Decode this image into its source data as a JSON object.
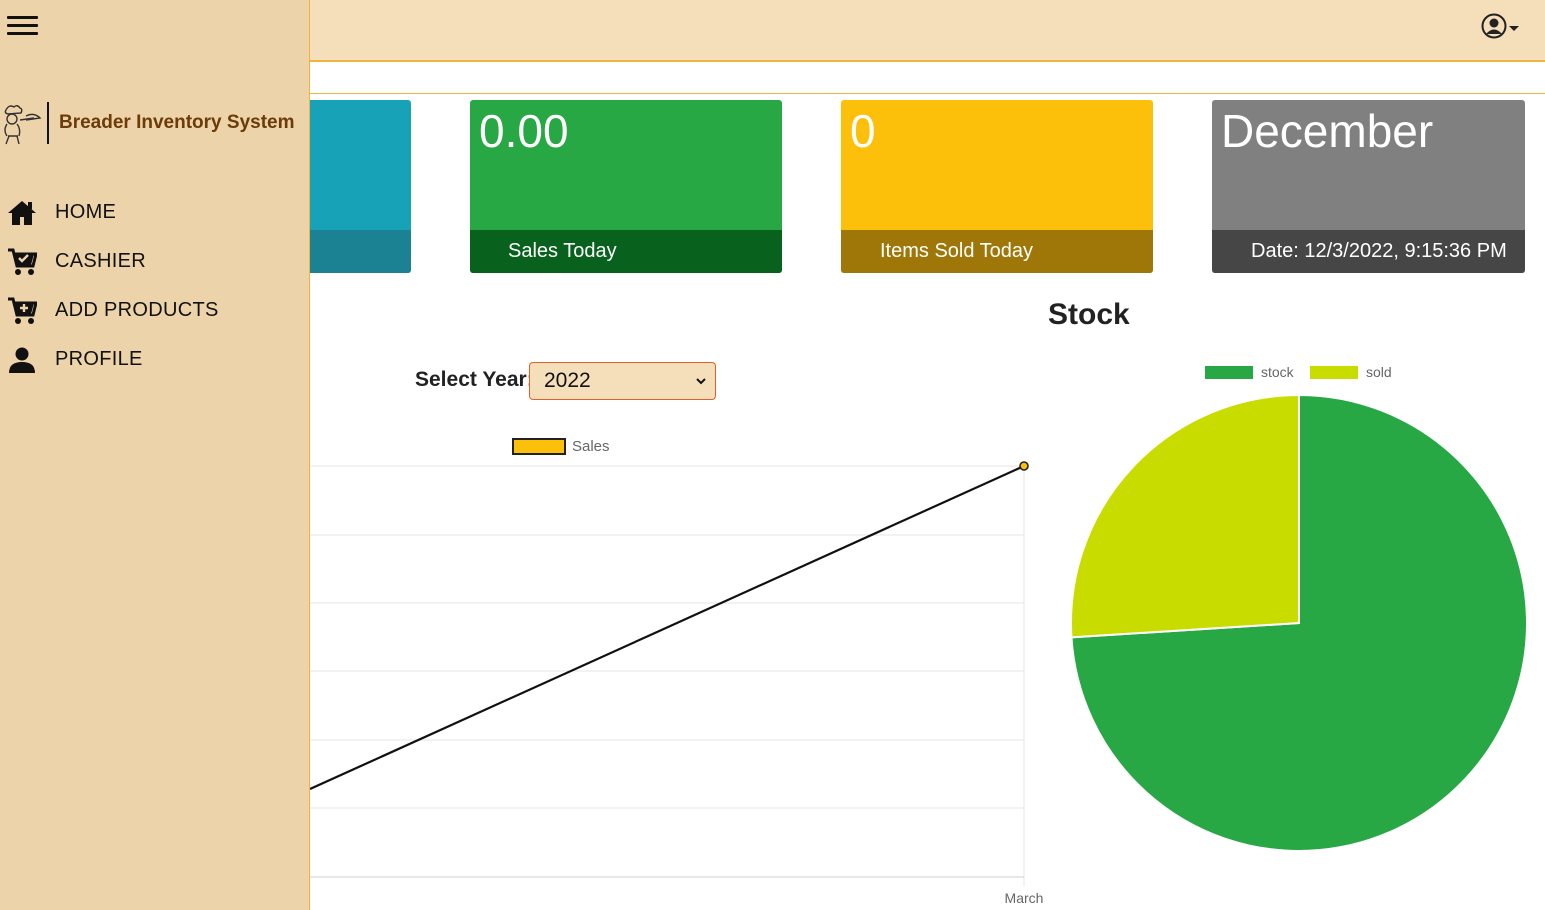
{
  "app": {
    "title": "Breader Inventory System"
  },
  "nav": {
    "items": [
      {
        "label": "HOME",
        "icon": "home-icon"
      },
      {
        "label": "CASHIER",
        "icon": "cart-check-icon"
      },
      {
        "label": "ADD PRODUCTS",
        "icon": "cart-plus-icon"
      },
      {
        "label": "PROFILE",
        "icon": "person-icon"
      }
    ]
  },
  "cards": [
    {
      "value": "",
      "label": "",
      "color": "#17a2b8"
    },
    {
      "value": "0.00",
      "label": "Sales Today",
      "color": "#28a745"
    },
    {
      "value": "0",
      "label": "Items Sold Today",
      "color": "#fdc00a"
    },
    {
      "value": "December",
      "label": "Date: 12/3/2022, 9:15:36 PM",
      "color": "#808080"
    }
  ],
  "filter": {
    "label": "Select Year:",
    "value": "2022"
  },
  "chart_data": [
    {
      "type": "line",
      "title": "",
      "x": [
        "March"
      ],
      "series": [
        {
          "name": "Sales",
          "color": "#fdc00a"
        }
      ],
      "legend_position": "top",
      "grid": true
    },
    {
      "type": "pie",
      "title": "Stock",
      "categories": [
        "stock",
        "sold"
      ],
      "values": [
        74,
        26
      ],
      "colors": [
        "#28a745",
        "#c8dc00"
      ],
      "legend_position": "top"
    }
  ]
}
